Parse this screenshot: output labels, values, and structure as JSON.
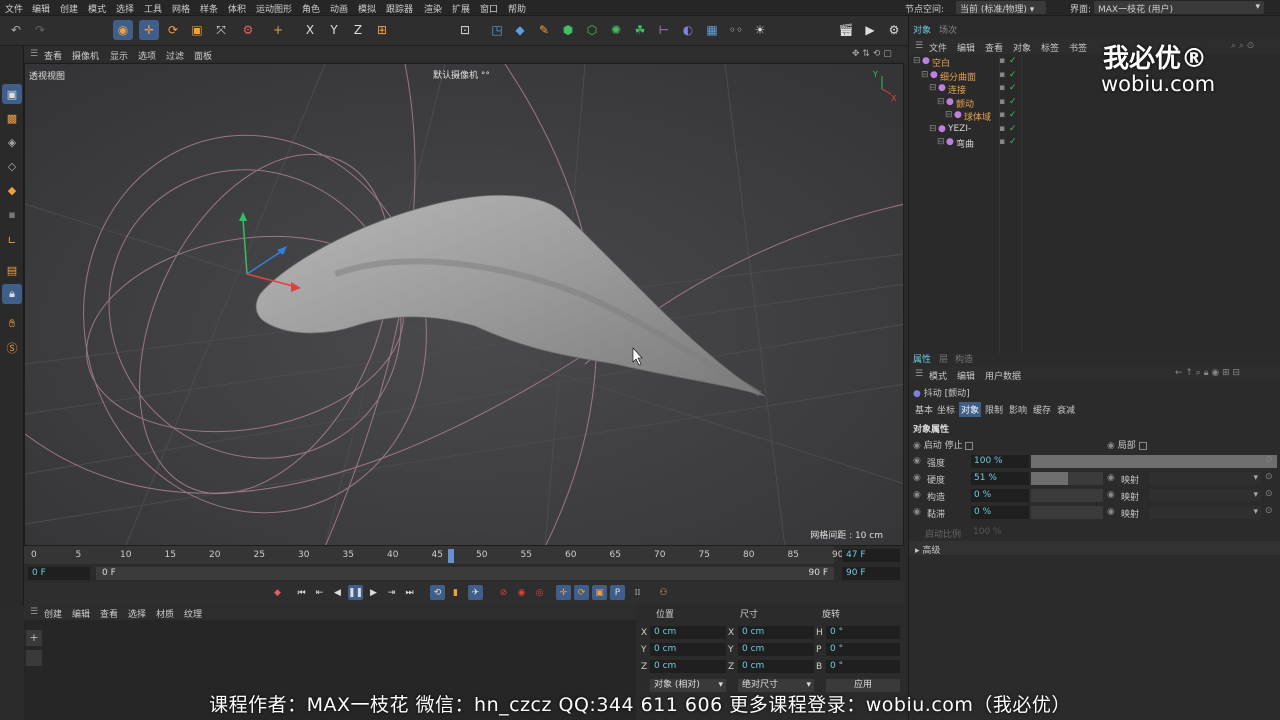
{
  "menu": {
    "items": [
      "文件",
      "编辑",
      "创建",
      "模式",
      "选择",
      "工具",
      "网格",
      "样条",
      "体积",
      "运动图形",
      "角色",
      "动画",
      "模拟",
      "跟踪器",
      "渲染",
      "扩展",
      "窗口",
      "帮助"
    ],
    "node_space_label": "节点空间:",
    "node_space_value": "当前 (标准/物理)",
    "layout_label": "界面:",
    "layout_value": "MAX一枝花 (用户)"
  },
  "toolbar": {
    "icons": [
      "undo-icon",
      "redo-icon",
      "live-select-icon",
      "move-icon",
      "rotate-icon",
      "scale-icon",
      "transform-icon",
      "recent-tool-icon",
      "add-icon",
      "x-axis-icon",
      "y-axis-icon",
      "z-axis-icon",
      "coord-system-icon",
      "render-view-icon",
      "camera-icon",
      "cube-icon",
      "pen-icon",
      "subdivision-icon",
      "cloner-icon",
      "deformer-icon",
      "mograph-icon",
      "field-icon",
      "sky-icon",
      "floor-icon",
      "scene-icon",
      "light-icon",
      "render-region-icon",
      "render-icon",
      "render-settings-icon"
    ],
    "axis_x": "X",
    "axis_y": "Y",
    "axis_z": "Z"
  },
  "viewport": {
    "menu": [
      "查看",
      "摄像机",
      "显示",
      "选项",
      "过滤",
      "面板"
    ],
    "name": "透视视图",
    "camera": "默认摄像机",
    "grid_spacing": "网格间距 : 10 cm"
  },
  "timeline": {
    "ticks": [
      "0",
      "5",
      "10",
      "15",
      "20",
      "25",
      "30",
      "35",
      "40",
      "45",
      "50",
      "55",
      "60",
      "65",
      "70",
      "75",
      "80",
      "85",
      "90"
    ],
    "current_frame": "47 F",
    "start": "0 F",
    "range_start": "0 F",
    "range_end": "90 F",
    "end": "90 F"
  },
  "materials": {
    "menu": [
      "创建",
      "编辑",
      "查看",
      "选择",
      "材质",
      "纹理"
    ]
  },
  "coordinates": {
    "headers": {
      "position": "位置",
      "size": "尺寸",
      "rotation": "旋转"
    },
    "rows": [
      {
        "axis": "X",
        "pos": "0 cm",
        "size_axis": "X",
        "size": "0 cm",
        "rot_axis": "H",
        "rot": "0 °"
      },
      {
        "axis": "Y",
        "pos": "0 cm",
        "size_axis": "Y",
        "size": "0 cm",
        "rot_axis": "P",
        "rot": "0 °"
      },
      {
        "axis": "Z",
        "pos": "0 cm",
        "size_axis": "Z",
        "size": "0 cm",
        "rot_axis": "B",
        "rot": "0 °"
      }
    ],
    "mode": "对象 (相对)",
    "size_mode": "绝对尺寸",
    "apply": "应用"
  },
  "object_manager": {
    "tabs": [
      "对象",
      "场次"
    ],
    "menu": [
      "文件",
      "编辑",
      "查看",
      "对象",
      "标签",
      "书签"
    ],
    "objects": [
      {
        "name": "空白",
        "color": "#e8a050",
        "indent": 0
      },
      {
        "name": "细分曲面",
        "color": "#e8a050",
        "indent": 1
      },
      {
        "name": "连接",
        "color": "#e8a050",
        "indent": 2
      },
      {
        "name": "颤动",
        "color": "#e8a050",
        "indent": 3
      },
      {
        "name": "球体域",
        "color": "#e8a050",
        "indent": 4
      },
      {
        "name": "YEZI-",
        "color": "#d8d8d8",
        "indent": 2
      },
      {
        "name": "弯曲",
        "color": "#d8d8d8",
        "indent": 3
      }
    ]
  },
  "attributes": {
    "tabs": [
      "属性",
      "层",
      "构造"
    ],
    "menu": [
      "模式",
      "编辑",
      "用户数据"
    ],
    "object_title": "抖动 [颤动]",
    "subtabs": [
      "基本",
      "坐标",
      "对象",
      "限制",
      "影响",
      "缓存",
      "衰减"
    ],
    "active_subtab": "对象",
    "section": "对象属性",
    "enable_label": "启动 停止",
    "local_label": "局部",
    "params": [
      {
        "label": "强度",
        "value": "100 %",
        "fill": 1.0,
        "map": ""
      },
      {
        "label": "硬度",
        "value": "51 %",
        "fill": 0.51,
        "map": "映射"
      },
      {
        "label": "构造",
        "value": "0 %",
        "fill": 0.0,
        "map": "映射"
      },
      {
        "label": "黏滞",
        "value": "0 %",
        "fill": 0.0,
        "map": "映射"
      }
    ],
    "disabled_param": {
      "label": "启动比例",
      "value": "100 %"
    },
    "advanced": "高级"
  },
  "watermark": {
    "brand": "我必优®",
    "site": "wobiu.com"
  },
  "caption": "课程作者：MAX一枝花   微信：hn_czcz   QQ:344 611 606   更多课程登录：wobiu.com（我必优）"
}
